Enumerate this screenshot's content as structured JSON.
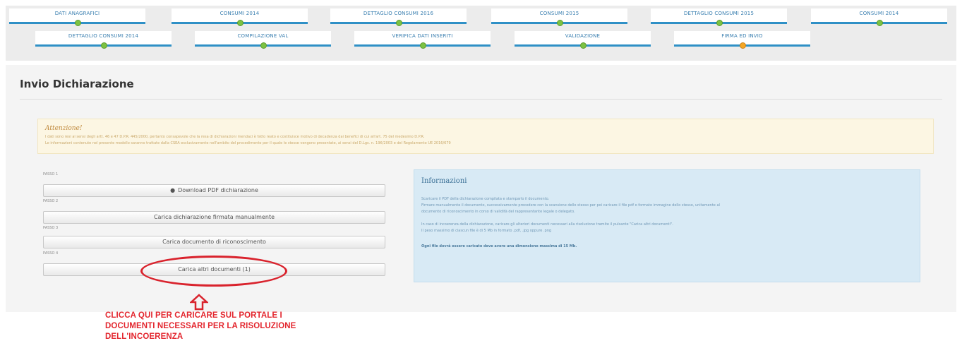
{
  "wizard": {
    "row1": [
      {
        "label": "DATI ANAGRAFICI",
        "status": "done"
      },
      {
        "label": "CONSUMI 2014",
        "status": "done"
      },
      {
        "label": "DETTAGLIO CONSUMI 2016",
        "status": "done"
      },
      {
        "label": "CONSUMI 2015",
        "status": "done"
      },
      {
        "label": "DETTAGLIO CONSUMI 2015",
        "status": "done"
      },
      {
        "label": "CONSUMI 2014",
        "status": "done"
      }
    ],
    "row2": [
      {
        "label": "DETTAGLIO CONSUMI 2014",
        "status": "done"
      },
      {
        "label": "COMPILAZIONE VAL",
        "status": "done"
      },
      {
        "label": "VERIFICA DATI INSERITI",
        "status": "done"
      },
      {
        "label": "VALIDAZIONE",
        "status": "done"
      },
      {
        "label": "FIRMA ED INVIO",
        "status": "current"
      }
    ]
  },
  "page": {
    "title": "Invio Dichiarazione"
  },
  "alert": {
    "title": "Attenzione!",
    "line1": "I dati sono resi ai sensi degli artt. 46 e 47 D.P.R. 445/2000, pertanto consapevole che la resa di dichiarazioni mendaci è fatto reato e costituisce motivo di decadenza dai benefici di cui all'art. 75 del medesimo D.P.R.",
    "line2": "Le informazioni contenute nel presente modello saranno trattate dalla CSEA esclusivamente nell'ambito del procedimento per il quale le stesse vengono presentate, ai sensi del D.Lgs. n. 196/2003 e del Regolamento UE 2016/679"
  },
  "steps": [
    {
      "step_label": "PASSO 1",
      "button_label": "Download PDF dichiarazione",
      "icon": "download-icon"
    },
    {
      "step_label": "PASSO 2",
      "button_label": "Carica dichiarazione firmata manualmente",
      "icon": ""
    },
    {
      "step_label": "PASSO 3",
      "button_label": "Carica documento di riconoscimento",
      "icon": ""
    },
    {
      "step_label": "PASSO 4",
      "button_label": "Carica altri documenti (1)",
      "icon": ""
    }
  ],
  "info": {
    "title": "Informazioni",
    "line1": "Scaricare il PDF della dichiarazione compilata e stamparlo il documento.",
    "line2": "Firmare manualmente il documento, successivamente procedere con la scansione dello stesso per poi caricare il file pdf o formato immagine dello stesso, unitamente al",
    "line3": "documento di riconoscimento in corso di validità del rappresentante legale o delegato.",
    "line4": "In caso di incoerenza della dichiarazione, caricare gli ulteriori documenti necessari alla risoluzione tramite il pulsante \"Carica altri documenti\".",
    "line5": "Il peso massimo di ciascun file è di 5 Mb in formato .pdf, .jpg oppure .png",
    "note": "Ogni file dovrà essere caricato deve avere una dimensione massima di 15 Mb."
  },
  "annotation": {
    "line1": "CLICCA QUI PER CARICARE SUL PORTALE I",
    "line2": "DOCUMENTI NECESSARI PER LA RISOLUZIONE",
    "line3": "DELL'INCOERENZA",
    "color": "#e3262e"
  }
}
